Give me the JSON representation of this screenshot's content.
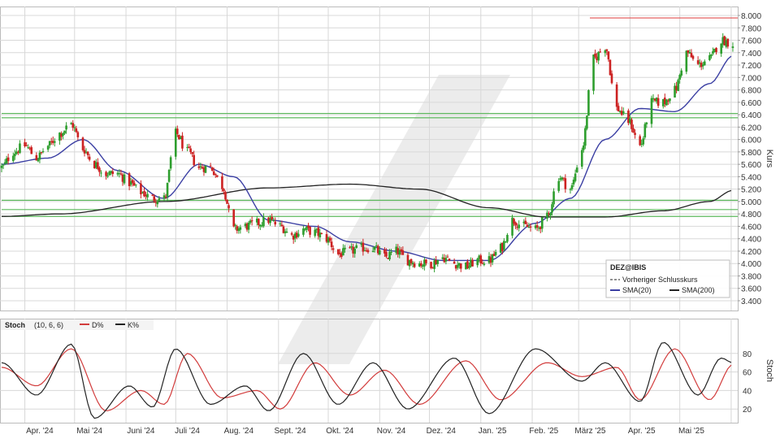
{
  "colors": {
    "up": "#2e9e2e",
    "down": "#cc2222",
    "sma20": "#3b3fa3",
    "sma200": "#222222",
    "support_lines": "#5cb85c",
    "resistance_line": "#e05050",
    "stoch_d": "#d23c3c",
    "stoch_k": "#222222",
    "grid": "#d8d8d8",
    "watermark": "#e6e6e6"
  },
  "chart_data": [
    {
      "type": "candlestick",
      "panel": "price",
      "symbol": "DEZ@IBIS",
      "ylabel": "Kurs",
      "ylim": [
        3.2,
        8.0
      ],
      "y_ticks": [
        "8.000",
        "7.800",
        "7.600",
        "7.400",
        "7.200",
        "7.000",
        "6.800",
        "6.600",
        "6.400",
        "6.200",
        "6.000",
        "5.800",
        "5.600",
        "5.400",
        "5.200",
        "5.000",
        "4.800",
        "4.600",
        "4.400",
        "4.200",
        "4.000",
        "3.800",
        "3.600",
        "3.400"
      ],
      "x_months": [
        "Apr. '24",
        "Mai '24",
        "Juni '24",
        "Juli '24",
        "Aug. '24",
        "Sept. '24",
        "Okt. '24",
        "Nov. '24",
        "Dez. '24",
        "Jan. '25",
        "Feb. '25",
        "März '25",
        "Apr. '25",
        "Mai '25"
      ],
      "legend": {
        "title": "DEZ@IBIS",
        "items": [
          "Vorheriger Schlusskurs",
          "SMA(20)",
          "SMA(200)"
        ]
      },
      "horizontal_lines": [
        {
          "name": "resistance",
          "value": 7.96,
          "color": "red"
        },
        {
          "name": "support",
          "value": 6.42,
          "color": "green"
        },
        {
          "name": "support",
          "value": 6.35,
          "color": "green"
        },
        {
          "name": "support",
          "value": 5.02,
          "color": "green"
        },
        {
          "name": "support",
          "value": 4.87,
          "color": "green"
        },
        {
          "name": "support",
          "value": 4.76,
          "color": "green"
        }
      ],
      "close_anchors": [
        [
          "2024-03-18",
          5.55
        ],
        [
          "2024-03-25",
          5.8
        ],
        [
          "2024-04-01",
          5.9
        ],
        [
          "2024-04-08",
          5.7
        ],
        [
          "2024-04-15",
          5.9
        ],
        [
          "2024-04-22",
          6.1
        ],
        [
          "2024-04-29",
          6.25
        ],
        [
          "2024-05-06",
          5.85
        ],
        [
          "2024-05-13",
          5.6
        ],
        [
          "2024-05-20",
          5.45
        ],
        [
          "2024-05-27",
          5.45
        ],
        [
          "2024-06-03",
          5.3
        ],
        [
          "2024-06-10",
          5.15
        ],
        [
          "2024-06-17",
          5.05
        ],
        [
          "2024-06-24",
          5.05
        ],
        [
          "2024-07-01",
          6.1
        ],
        [
          "2024-07-08",
          5.8
        ],
        [
          "2024-07-15",
          5.55
        ],
        [
          "2024-07-22",
          5.55
        ],
        [
          "2024-07-29",
          5.25
        ],
        [
          "2024-08-05",
          4.55
        ],
        [
          "2024-08-12",
          4.6
        ],
        [
          "2024-08-19",
          4.65
        ],
        [
          "2024-08-26",
          4.7
        ],
        [
          "2024-09-02",
          4.6
        ],
        [
          "2024-09-09",
          4.45
        ],
        [
          "2024-09-16",
          4.55
        ],
        [
          "2024-09-23",
          4.5
        ],
        [
          "2024-09-30",
          4.4
        ],
        [
          "2024-10-07",
          4.15
        ],
        [
          "2024-10-14",
          4.2
        ],
        [
          "2024-10-21",
          4.25
        ],
        [
          "2024-10-28",
          4.25
        ],
        [
          "2024-11-04",
          4.1
        ],
        [
          "2024-11-11",
          4.2
        ],
        [
          "2024-11-18",
          4.05
        ],
        [
          "2024-11-25",
          4.0
        ],
        [
          "2024-12-02",
          4.0
        ],
        [
          "2024-12-09",
          4.1
        ],
        [
          "2024-12-16",
          4.0
        ],
        [
          "2024-12-23",
          3.95
        ],
        [
          "2024-12-30",
          4.05
        ],
        [
          "2025-01-06",
          4.05
        ],
        [
          "2025-01-13",
          4.25
        ],
        [
          "2025-01-20",
          4.7
        ],
        [
          "2025-01-27",
          4.6
        ],
        [
          "2025-02-03",
          4.55
        ],
        [
          "2025-02-10",
          4.75
        ],
        [
          "2025-02-17",
          5.4
        ],
        [
          "2025-02-24",
          5.2
        ],
        [
          "2025-03-03",
          5.85
        ],
        [
          "2025-03-10",
          7.3
        ],
        [
          "2025-03-17",
          7.5
        ],
        [
          "2025-03-24",
          6.5
        ],
        [
          "2025-03-31",
          6.3
        ],
        [
          "2025-04-07",
          5.9
        ],
        [
          "2025-04-14",
          6.6
        ],
        [
          "2025-04-21",
          6.6
        ],
        [
          "2025-04-28",
          6.8
        ],
        [
          "2025-05-05",
          7.4
        ],
        [
          "2025-05-12",
          7.2
        ],
        [
          "2025-05-19",
          7.3
        ],
        [
          "2025-05-26",
          7.6
        ],
        [
          "2025-06-02",
          7.55
        ]
      ],
      "sma20_anchors": [
        [
          "2024-03-18",
          5.6
        ],
        [
          "2024-04-15",
          5.7
        ],
        [
          "2024-05-06",
          6.0
        ],
        [
          "2024-05-27",
          5.5
        ],
        [
          "2024-06-24",
          5.05
        ],
        [
          "2024-07-15",
          5.6
        ],
        [
          "2024-08-05",
          5.4
        ],
        [
          "2024-08-26",
          4.7
        ],
        [
          "2024-09-23",
          4.6
        ],
        [
          "2024-10-14",
          4.35
        ],
        [
          "2024-11-11",
          4.2
        ],
        [
          "2024-12-09",
          4.05
        ],
        [
          "2025-01-06",
          4.05
        ],
        [
          "2025-02-03",
          4.65
        ],
        [
          "2025-02-24",
          5.05
        ],
        [
          "2025-03-17",
          6.0
        ],
        [
          "2025-04-07",
          6.5
        ],
        [
          "2025-04-28",
          6.45
        ],
        [
          "2025-05-19",
          6.9
        ],
        [
          "2025-06-02",
          7.35
        ]
      ],
      "sma200_anchors": [
        [
          "2024-03-18",
          4.76
        ],
        [
          "2024-04-22",
          4.8
        ],
        [
          "2024-06-24",
          5.0
        ],
        [
          "2024-08-26",
          5.22
        ],
        [
          "2024-10-14",
          5.28
        ],
        [
          "2024-11-25",
          5.2
        ],
        [
          "2025-01-06",
          4.9
        ],
        [
          "2025-02-10",
          4.75
        ],
        [
          "2025-03-17",
          4.75
        ],
        [
          "2025-04-21",
          4.85
        ],
        [
          "2025-05-19",
          5.0
        ],
        [
          "2025-06-02",
          5.18
        ]
      ]
    },
    {
      "type": "line",
      "panel": "oscillator",
      "title": "Stoch",
      "params": "(10, 6, 6)",
      "ylabel": "Stoch",
      "ylim": [
        0,
        100
      ],
      "y_ticks": [
        "80",
        "60",
        "40",
        "20"
      ],
      "series": [
        {
          "name": "D%",
          "color": "red",
          "anchors": [
            [
              "2024-03-18",
              65
            ],
            [
              "2024-04-08",
              45
            ],
            [
              "2024-04-29",
              85
            ],
            [
              "2024-05-20",
              18
            ],
            [
              "2024-06-10",
              40
            ],
            [
              "2024-06-24",
              25
            ],
            [
              "2024-07-08",
              80
            ],
            [
              "2024-07-29",
              32
            ],
            [
              "2024-08-19",
              40
            ],
            [
              "2024-09-02",
              20
            ],
            [
              "2024-09-23",
              70
            ],
            [
              "2024-10-14",
              35
            ],
            [
              "2024-11-04",
              62
            ],
            [
              "2024-11-25",
              25
            ],
            [
              "2024-12-23",
              72
            ],
            [
              "2025-01-13",
              30
            ],
            [
              "2025-02-10",
              70
            ],
            [
              "2025-03-03",
              55
            ],
            [
              "2025-03-24",
              65
            ],
            [
              "2025-04-07",
              30
            ],
            [
              "2025-04-28",
              85
            ],
            [
              "2025-05-19",
              30
            ],
            [
              "2025-06-02",
              68
            ]
          ]
        },
        {
          "name": "K%",
          "color": "black",
          "anchors": [
            [
              "2024-03-18",
              70
            ],
            [
              "2024-04-08",
              35
            ],
            [
              "2024-04-29",
              90
            ],
            [
              "2024-05-13",
              10
            ],
            [
              "2024-06-03",
              45
            ],
            [
              "2024-06-17",
              22
            ],
            [
              "2024-07-01",
              85
            ],
            [
              "2024-07-22",
              25
            ],
            [
              "2024-08-12",
              45
            ],
            [
              "2024-08-26",
              18
            ],
            [
              "2024-09-16",
              80
            ],
            [
              "2024-10-07",
              25
            ],
            [
              "2024-10-28",
              70
            ],
            [
              "2024-11-18",
              20
            ],
            [
              "2024-12-16",
              75
            ],
            [
              "2025-01-06",
              15
            ],
            [
              "2025-02-03",
              85
            ],
            [
              "2025-03-03",
              50
            ],
            [
              "2025-03-17",
              70
            ],
            [
              "2025-04-07",
              28
            ],
            [
              "2025-04-21",
              92
            ],
            [
              "2025-05-12",
              35
            ],
            [
              "2025-05-26",
              75
            ],
            [
              "2025-06-02",
              70
            ]
          ]
        }
      ]
    }
  ],
  "watermark": {
    "shape": "slash"
  }
}
